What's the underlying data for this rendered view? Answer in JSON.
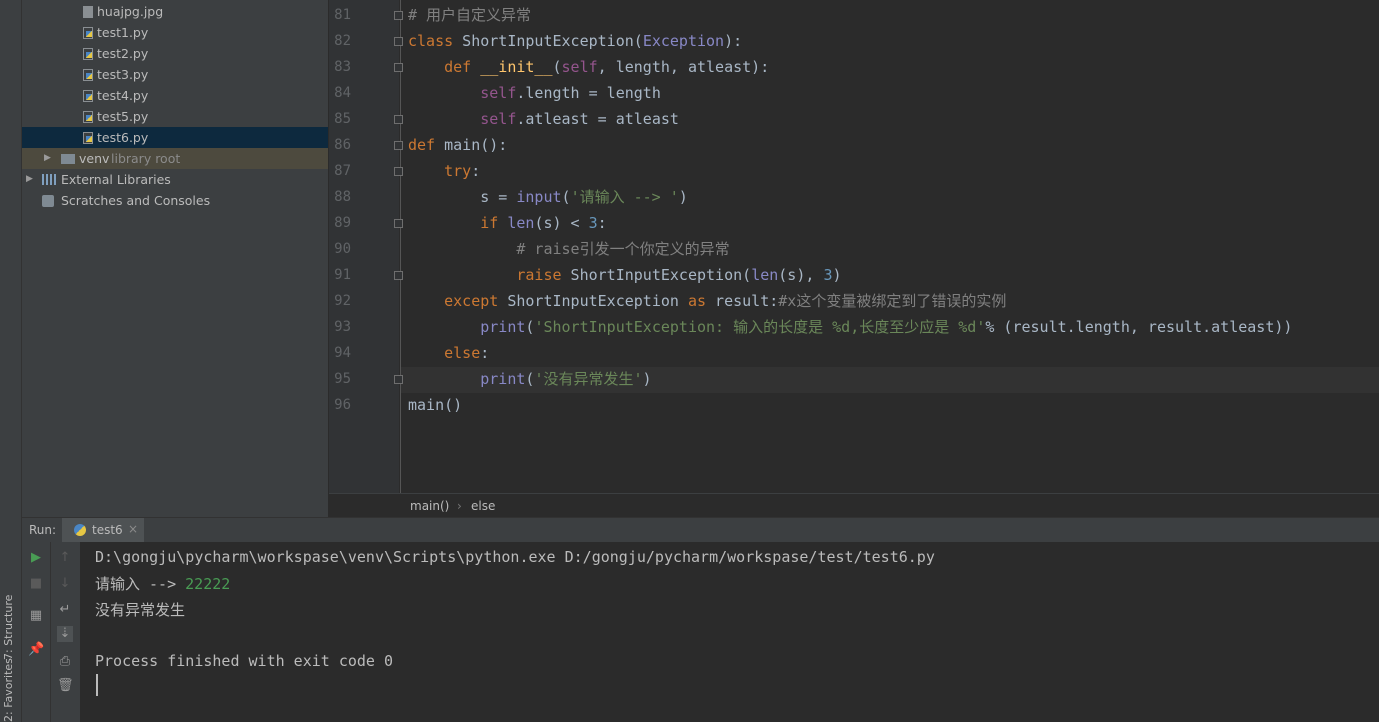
{
  "side_strip": {
    "structure": "7: Structure",
    "favorites": "2: Favorites"
  },
  "project_tree": [
    {
      "name": "huajpg.jpg",
      "type": "jpg"
    },
    {
      "name": "test1.py",
      "type": "py"
    },
    {
      "name": "test2.py",
      "type": "py"
    },
    {
      "name": "test3.py",
      "type": "py"
    },
    {
      "name": "test4.py",
      "type": "py"
    },
    {
      "name": "test5.py",
      "type": "py"
    },
    {
      "name": "test6.py",
      "type": "py",
      "selected": true
    }
  ],
  "venv": {
    "name": "venv",
    "suffix": "library root"
  },
  "external_libraries": "External Libraries",
  "scratches": "Scratches and Consoles",
  "editor": {
    "line_numbers": [
      "81",
      "82",
      "83",
      "84",
      "85",
      "86",
      "87",
      "88",
      "89",
      "90",
      "91",
      "92",
      "93",
      "94",
      "95",
      "96"
    ],
    "code": [
      "# 用户自定义异常",
      "class ShortInputException(Exception):",
      "    def __init__(self, length, atleast):",
      "        self.length = length",
      "        self.atleast = atleast",
      "def main():",
      "    try:",
      "        s = input('请输入 --> ')",
      "        if len(s) < 3:",
      "            # raise引发一个你定义的异常",
      "            raise ShortInputException(len(s), 3)",
      "    except ShortInputException as result:#x这个变量被绑定到了错误的实例",
      "        print('ShortInputException: 输入的长度是 %d,长度至少应是 %d'% (result.length, result.atleast))",
      "    else:",
      "        print('没有异常发生')",
      "main()"
    ],
    "breadcrumb": [
      "main()",
      "else"
    ]
  },
  "run": {
    "label": "Run:",
    "tab": "test6",
    "console": {
      "command": "D:\\gongju\\pycharm\\workspase\\venv\\Scripts\\python.exe D:/gongju/pycharm/workspase/test/test6.py",
      "prompt": "请输入 --> ",
      "input": "22222",
      "output": "没有异常发生",
      "finished": "Process finished with exit code 0"
    }
  },
  "colors": {
    "keyword": "#cc7832",
    "string": "#6a8759",
    "comment": "#808080",
    "number": "#6897bb",
    "self": "#94558d",
    "builtin": "#8888c6",
    "selection": "#0d293e",
    "run_green": "#499c54"
  }
}
